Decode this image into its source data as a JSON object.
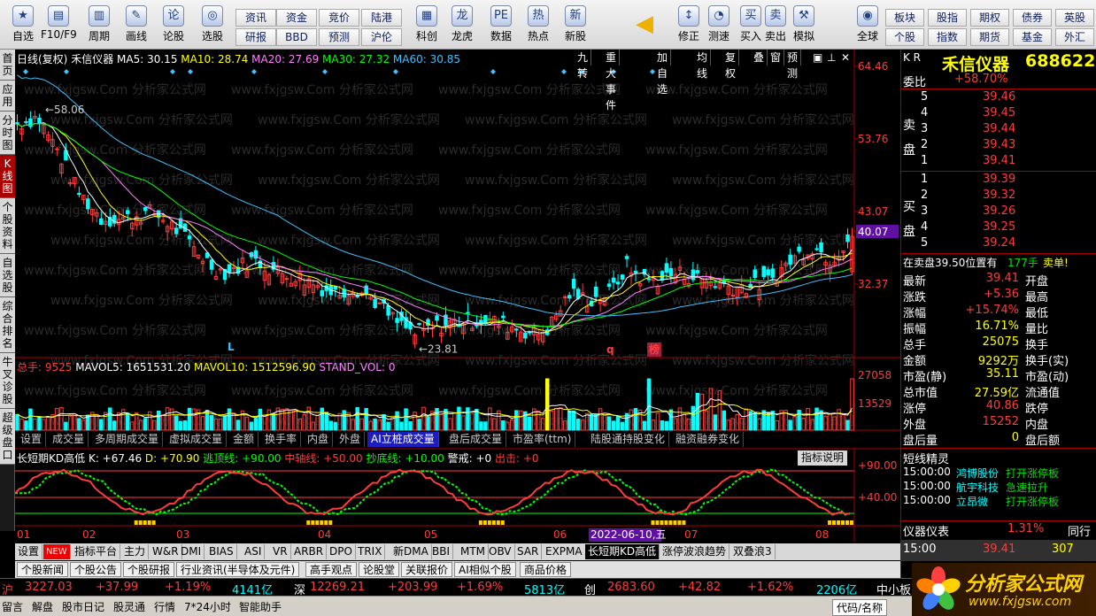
{
  "toolbar": {
    "buttons": [
      {
        "label": "自选",
        "icon": "star-icon"
      },
      {
        "label": "F10/F9",
        "icon": "f10-icon"
      },
      {
        "label": "周期",
        "icon": "cycle-icon"
      },
      {
        "label": "画线",
        "icon": "pen-icon"
      },
      {
        "label": "论股",
        "icon": "discuss-icon"
      },
      {
        "label": "选股",
        "icon": "select-stock-icon"
      },
      {
        "label": "科创",
        "icon": "kechuang-icon"
      },
      {
        "label": "龙虎",
        "icon": "dragon-tiger-icon"
      },
      {
        "label": "数据",
        "icon": "data-icon"
      },
      {
        "label": "热点",
        "icon": "hot-icon"
      },
      {
        "label": "新股",
        "icon": "new-stock-icon"
      },
      {
        "label": "修正",
        "icon": "revise-icon"
      },
      {
        "label": "测速",
        "icon": "speed-icon"
      },
      {
        "label": "买入",
        "icon": "buy-icon"
      },
      {
        "label": "卖出",
        "icon": "sell-icon"
      },
      {
        "label": "模拟",
        "icon": "simulate-icon"
      },
      {
        "label": "全球",
        "icon": "globe-icon"
      }
    ],
    "small_buttons": [
      "资讯",
      "资金",
      "竞价",
      "陆港",
      "研报",
      "BBD",
      "预测",
      "沪伦",
      "板块",
      "股指",
      "期权",
      "债券",
      "英股",
      "个股",
      "指数",
      "期货",
      "基金",
      "外汇"
    ]
  },
  "left_tabs": [
    "首页",
    "应用",
    "分时图",
    "K线图",
    "个股资料",
    "自选股",
    "综合排名",
    "牛叉诊股",
    "超级盘口"
  ],
  "main_chart": {
    "header": "日线(复权)",
    "stock_name": "禾信仪器",
    "ma5": "MA5: 30.15",
    "ma10": "MA10: 28.74",
    "ma20": "MA20: 27.69",
    "ma30": "MA30: 27.32",
    "ma60": "MA60: 30.85",
    "top_buttons": [
      "九转",
      "重大事件",
      "加自选",
      "均线",
      "复权",
      "叠",
      "窗",
      "预测"
    ],
    "price_labels": [
      "64.46",
      "53.76",
      "43.07",
      "40.07",
      "32.37"
    ],
    "high_label": "58.06",
    "low_label": "23.81",
    "markers": [
      "L",
      "q",
      "榜"
    ],
    "watermark": "www.fxjgsw.Com 分析家公式网"
  },
  "volume": {
    "legend_title": "总手: 9525",
    "mavol5": "MAVOL5: 1651531.20",
    "mavol10": "MAVOL10: 1512596.90",
    "stand_vol": "STAND_VOL: 0",
    "labels": [
      "27058",
      "13529"
    ]
  },
  "sub_tabs": [
    "设置",
    "成交量",
    "多周期成交量",
    "虚拟成交量",
    "金额",
    "换手率",
    "内盘",
    "外盘",
    "AI立桩成交量",
    "盘后成交量",
    "市盈率(ttm)",
    "陆股通持股变化",
    "融资融券变化"
  ],
  "kd": {
    "title": "长短期KD高低",
    "k": "K: +67.46",
    "d": "D: +70.90",
    "escape": "逃顶线: +90.00",
    "middle": "中轴线: +50.00",
    "bottom": "抄底线: +10.00",
    "warn": "警戒: +0",
    "out": "出击: +0",
    "help": "指标说明",
    "labels": [
      "+90.00",
      "+40.00"
    ]
  },
  "x_axis": {
    "months": [
      "01",
      "02",
      "03",
      "04",
      "05",
      "06",
      "07",
      "08"
    ],
    "date_label": "2022-06-10,五"
  },
  "indicator_tabs": [
    "设置",
    "NEW",
    "指标平台",
    "主力",
    "W&R",
    "DMI",
    "BIAS",
    "ASI",
    "VR",
    "ARBR",
    "DPO",
    "TRIX",
    "新DMA",
    "BBI",
    "MTM",
    "OBV",
    "SAR",
    "EXPMA",
    "长短期KD高低",
    "涨停波浪趋势",
    "双叠浪3"
  ],
  "news_tabs": [
    "个股新闻",
    "个股公告",
    "个股研报",
    "行业资讯(半导体及元件)",
    "高手观点",
    "论股堂",
    "关联报价",
    "AI相似个股",
    "商品价格"
  ],
  "right_panel": {
    "kr": "K R",
    "name": "禾信仪器",
    "code": "688622",
    "wei_bi_label": "委比",
    "wei_bi": "+58.70%",
    "sell_label": "卖盘",
    "buy_label": "买盘",
    "sell": [
      {
        "n": "5",
        "p": "39.46"
      },
      {
        "n": "4",
        "p": "39.45"
      },
      {
        "n": "3",
        "p": "39.44"
      },
      {
        "n": "2",
        "p": "39.43"
      },
      {
        "n": "1",
        "p": "39.41"
      }
    ],
    "buy": [
      {
        "n": "1",
        "p": "39.39"
      },
      {
        "n": "2",
        "p": "39.32"
      },
      {
        "n": "3",
        "p": "39.26"
      },
      {
        "n": "4",
        "p": "39.25"
      },
      {
        "n": "5",
        "p": "39.24"
      }
    ],
    "order_note": "在卖盘39.50位置有",
    "order_qty": "177手",
    "order_tag": "卖单!",
    "stats": [
      {
        "l": "最新",
        "v": "39.41",
        "r": "开盘"
      },
      {
        "l": "涨跌",
        "v": "+5.36",
        "r": "最高"
      },
      {
        "l": "涨幅",
        "v": "+15.74%",
        "r": "最低"
      },
      {
        "l": "振幅",
        "v": "16.71%",
        "r": "量比"
      },
      {
        "l": "总手",
        "v": "25075",
        "r": "换手"
      },
      {
        "l": "金额",
        "v": "9292万",
        "r": "换手(实)"
      },
      {
        "l": "市盈(静)",
        "v": "35.11",
        "r": "市盈(动)"
      },
      {
        "l": "总市值",
        "v": "27.59亿",
        "r": "流通值"
      },
      {
        "l": "涨停",
        "v": "40.86",
        "r": "跌停"
      },
      {
        "l": "外盘",
        "v": "15252",
        "r": "内盘"
      },
      {
        "l": "盘后量",
        "v": "0",
        "r": "盘后额"
      }
    ],
    "short_title": "短线精灵",
    "short_items": [
      {
        "t": "15:00:00",
        "s": "鸿博股份",
        "e": "打开涨停板"
      },
      {
        "t": "15:00:00",
        "s": "航宇科技",
        "e": "急速拉升"
      },
      {
        "t": "15:00:00",
        "s": "立昂微",
        "e": "打开涨停板"
      }
    ],
    "instrument_label": "仪器仪表",
    "instrument_pct": "1.31%",
    "instrument_extra": "同行",
    "last_time": "15:00",
    "last_price": "39.41",
    "last_vol": "307"
  },
  "index_bar": {
    "sh_label": "沪",
    "sh_val": "3227.03",
    "sh_chg": "+37.99",
    "sh_pct": "+1.19%",
    "sh_amt": "4141亿",
    "sz_label": "深",
    "sz_val": "12269.21",
    "sz_chg": "+203.99",
    "sz_pct": "+1.69%",
    "sz_amt": "5813亿",
    "cy_label": "创",
    "cy_val": "2683.60",
    "cy_chg": "+42.82",
    "cy_pct": "+1.62%",
    "cy_amt": "2206亿",
    "zx_label": "中小板"
  },
  "status_bar": [
    "留言",
    "解盘",
    "股市日记",
    "股灵通",
    "行情",
    "7*24小时",
    "智能助手"
  ],
  "status_right": "代码/名称",
  "brand": {
    "title": "分析家公式网",
    "url": "www.fxjgsw.com"
  },
  "colors": {
    "up": "#ff3c3c",
    "down": "#00ffff",
    "ma5": "#ffffff",
    "ma10": "#ffff00",
    "ma20": "#ff80ff",
    "ma30": "#00ff00",
    "ma60": "#40c0ff"
  }
}
